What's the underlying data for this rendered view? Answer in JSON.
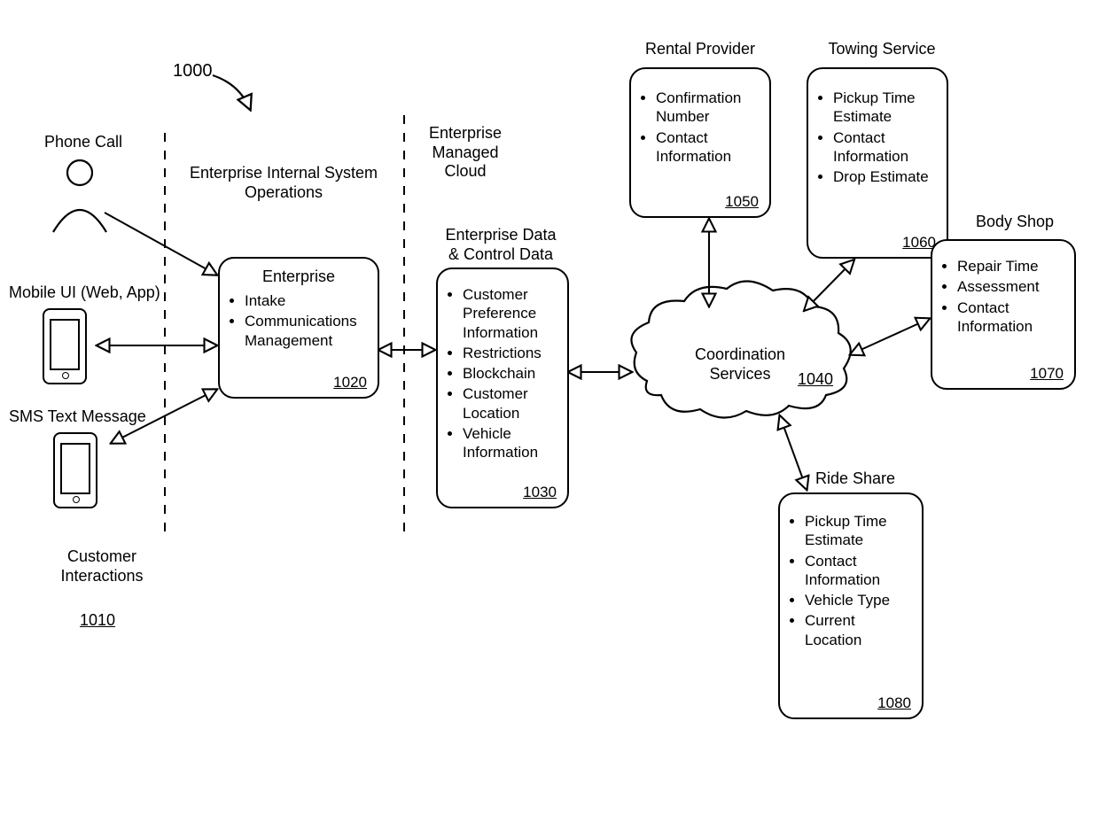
{
  "figureRef": "1000",
  "labels": {
    "phoneCall": "Phone Call",
    "mobileUI": "Mobile UI (Web, App)",
    "sms": "SMS Text Message",
    "customerInteractions": "Customer\nInteractions",
    "ciRef": "1010",
    "internalOps": "Enterprise Internal System\nOperations",
    "managedCloud": "Enterprise\nManaged\nCloud",
    "enterpriseDataTitle": "Enterprise Data\n& Control Data",
    "rentalTitle": "Rental Provider",
    "towingTitle": "Towing Service",
    "bodyShopTitle": "Body Shop",
    "rideShareTitle": "Ride Share",
    "coordTitle": "Coordination\nServices",
    "coordRef": "1040"
  },
  "enterprise": {
    "title": "Enterprise",
    "items": [
      "Intake",
      "Communications Management"
    ],
    "ref": "1020"
  },
  "enterpriseData": {
    "items": [
      "Customer Preference Information",
      "Restrictions",
      "Blockchain",
      "Customer Location",
      "Vehicle Information"
    ],
    "ref": "1030"
  },
  "rental": {
    "items": [
      "Confirmation Number",
      "Contact Information"
    ],
    "ref": "1050"
  },
  "towing": {
    "items": [
      "Pickup Time Estimate",
      "Contact Information",
      "Drop Estimate"
    ],
    "ref": "1060"
  },
  "bodyShop": {
    "items": [
      "Repair Time",
      "Assessment",
      "Contact Information"
    ],
    "ref": "1070"
  },
  "rideShare": {
    "items": [
      "Pickup Time Estimate",
      "Contact Information",
      "Vehicle Type",
      "Current Location"
    ],
    "ref": "1080"
  }
}
